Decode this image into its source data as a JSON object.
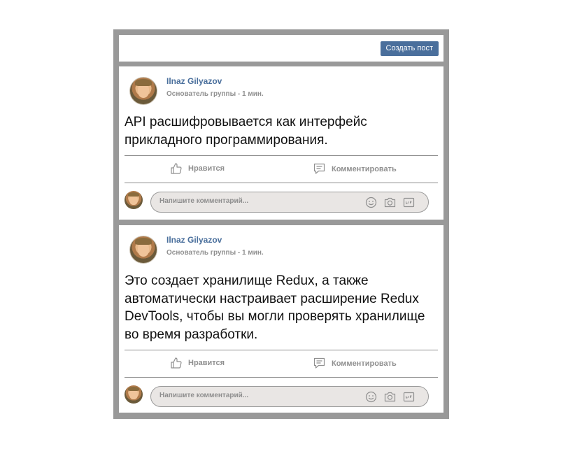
{
  "toolbar": {
    "create_post_label": "Создать пост"
  },
  "posts": [
    {
      "author": "Ilnaz Gilyazov",
      "meta": "Основатель группы - 1 мин.",
      "text": "API расшифровывается как интерфейс прикладного программирования.",
      "like_label": "Нравится",
      "comment_label": "Комментировать",
      "comment_placeholder": "Напишите комментарий..."
    },
    {
      "author": "Ilnaz Gilyazov",
      "meta": "Основатель группы - 1 мин.",
      "text": "Это создает хранилище Redux, а также автоматически настраивает расширение Redux DevTools, чтобы вы могли проверять хранилище во время разработки.",
      "like_label": "Нравится",
      "comment_label": "Комментировать",
      "comment_placeholder": "Напишите комментарий..."
    }
  ],
  "icons": {
    "like": "thumbs-up-icon",
    "comment": "comment-bubble-icon",
    "emoji": "smiley-icon",
    "photo": "camera-icon",
    "gif": "gif-icon"
  },
  "colors": {
    "frame": "#999999",
    "accent": "#4a6f9c",
    "muted": "#8f8f8f"
  }
}
